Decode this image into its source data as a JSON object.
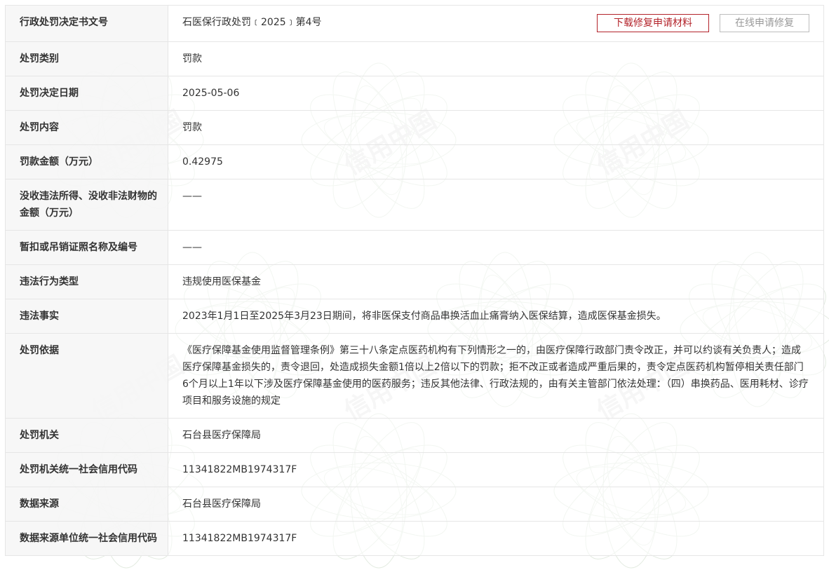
{
  "actions": {
    "download_label": "下载修复申请材料",
    "online_label": "在线申请修复"
  },
  "watermark": {
    "text": "信用中国"
  },
  "rows": [
    {
      "label": "行政处罚决定书文号",
      "value": "石医保行政处罚﹝2025﹞第4号"
    },
    {
      "label": "处罚类别",
      "value": "罚款"
    },
    {
      "label": "处罚决定日期",
      "value": "2025-05-06"
    },
    {
      "label": "处罚内容",
      "value": "罚款"
    },
    {
      "label": "罚款金额（万元）",
      "value": "0.42975"
    },
    {
      "label": "没收违法所得、没收非法财物的金额（万元）",
      "value": "——"
    },
    {
      "label": "暂扣或吊销证照名称及编号",
      "value": "——"
    },
    {
      "label": "违法行为类型",
      "value": "违规使用医保基金"
    },
    {
      "label": "违法事实",
      "value": "2023年1月1日至2025年3月23日期间，将非医保支付商品串换活血止痛膏纳入医保结算，造成医保基金损失。"
    },
    {
      "label": "处罚依据",
      "value": "《医疗保障基金使用监督管理条例》第三十八条定点医药机构有下列情形之一的，由医疗保障行政部门责令改正，并可以约谈有关负责人；造成医疗保障基金损失的，责令退回，处造成损失金额1倍以上2倍以下的罚款；拒不改正或者造成严重后果的，责令定点医药机构暂停相关责任部门6个月以上1年以下涉及医疗保障基金使用的医药服务；违反其他法律、行政法规的，由有关主管部门依法处理：（四）串换药品、医用耗材、诊疗项目和服务设施的规定"
    },
    {
      "label": "处罚机关",
      "value": "石台县医疗保障局"
    },
    {
      "label": "处罚机关统一社会信用代码",
      "value": "11341822MB1974317F"
    },
    {
      "label": "数据来源",
      "value": "石台县医疗保障局"
    },
    {
      "label": "数据来源单位统一社会信用代码",
      "value": "11341822MB1974317F"
    }
  ]
}
